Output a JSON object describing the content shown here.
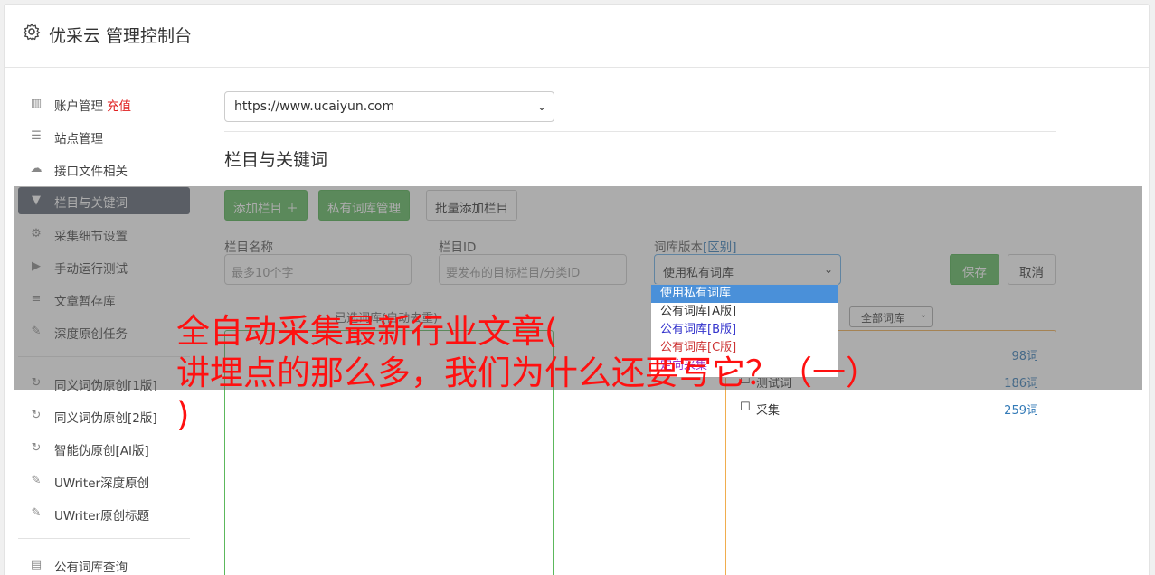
{
  "app": {
    "title": "优采云 管理控制台",
    "icon": "gear-icon"
  },
  "sidebar": {
    "items": [
      {
        "label": "账户管理",
        "extra": "充值",
        "icon": "bar-chart-icon"
      },
      {
        "label": "站点管理",
        "icon": "server-icon"
      },
      {
        "label": "接口文件相关",
        "icon": "cloud-upload-icon"
      },
      {
        "label": "栏目与关键词",
        "icon": "filter-icon",
        "active": true
      },
      {
        "label": "采集细节设置",
        "icon": "cogs-icon"
      },
      {
        "label": "手动运行测试",
        "icon": "play-circle-icon"
      },
      {
        "label": "文章暂存库",
        "icon": "database-icon"
      },
      {
        "label": "深度原创任务",
        "icon": "edit-icon"
      },
      {
        "label": "同义词伪原创[1版]",
        "icon": "refresh-icon"
      },
      {
        "label": "同义词伪原创[2版]",
        "icon": "refresh-icon"
      },
      {
        "label": "智能伪原创[AI版]",
        "icon": "refresh-icon"
      },
      {
        "label": "UWriter深度原创",
        "icon": "edit-icon"
      },
      {
        "label": "UWriter原创标题",
        "icon": "edit-icon"
      },
      {
        "label": "公有词库查询",
        "icon": "book-icon"
      }
    ]
  },
  "main": {
    "site_select": "https://www.ucaiyun.com",
    "section_title": "栏目与关键词",
    "buttons": {
      "add_column": "添加栏目 ＋",
      "private_lib": "私有词库管理",
      "batch_add": "批量添加栏目",
      "save": "保存",
      "cancel": "取消"
    },
    "form": {
      "name_label": "栏目名称",
      "name_placeholder": "最多10个字",
      "id_label": "栏目ID",
      "id_placeholder": "要发布的目标栏目/分类ID",
      "version_label": "词库版本",
      "version_link": "[区别]",
      "version_value": "使用私有词库"
    },
    "dropdown_options": [
      {
        "label": "使用私有词库",
        "color": "#ffffff",
        "selected": true
      },
      {
        "label": "公有词库[A版]",
        "color": "#333333"
      },
      {
        "label": "公有词库[B版]",
        "color": "#3333cc"
      },
      {
        "label": "公有词库[C版]",
        "color": "#cc3333"
      },
      {
        "label": "定向采集",
        "color": "#9933cc"
      }
    ],
    "panel_left_title": "已选词库(自动去重)",
    "lib_filter": "全部词库",
    "libraries": [
      {
        "name": "",
        "count": "98词"
      },
      {
        "name": "测试词",
        "count": "186词"
      },
      {
        "name": "采集",
        "count": "259词"
      }
    ]
  },
  "caption": {
    "line1": "全自动采集最新行业文章(",
    "line2": "讲埋点的那么多，我们为什么还要写它？（一）",
    "line3": ")"
  }
}
